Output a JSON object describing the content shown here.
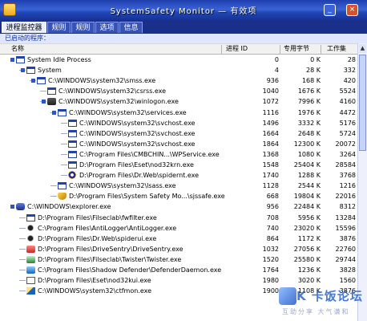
{
  "window": {
    "title": "SystemSafety Monitor — 有效项",
    "minimize_glyph": "_",
    "close_glyph": "×"
  },
  "tabs": [
    {
      "label": "进程监控器",
      "active": true
    },
    {
      "label": "规则",
      "active": false
    },
    {
      "label": "规则",
      "active": false
    },
    {
      "label": "选项",
      "active": false
    },
    {
      "label": "信息",
      "active": false
    }
  ],
  "subheader": "已启动的程序：",
  "columns": {
    "name": "名称",
    "pid": "进程 ID",
    "private_bytes": "专用字节",
    "working_set": "工作集"
  },
  "processes": [
    {
      "name": "System Idle Process",
      "pid": "0",
      "private": "0 K",
      "ws": "28",
      "depth": 0,
      "icon": "window-icon"
    },
    {
      "name": "System",
      "pid": "4",
      "private": "28 K",
      "ws": "332",
      "depth": 1,
      "icon": "window-icon"
    },
    {
      "name": "C:\\WINDOWS\\system32\\smss.exe",
      "pid": "936",
      "private": "168 K",
      "ws": "420",
      "depth": 2,
      "icon": "window-icon"
    },
    {
      "name": "C:\\WINDOWS\\system32\\csrss.exe",
      "pid": "1040",
      "private": "1676 K",
      "ws": "5524",
      "depth": 3,
      "icon": "window-icon"
    },
    {
      "name": "C:\\WINDOWS\\system32\\winlogon.exe",
      "pid": "1072",
      "private": "7996 K",
      "ws": "4160",
      "depth": 3,
      "icon": "lock-icon"
    },
    {
      "name": "C:\\WINDOWS\\system32\\services.exe",
      "pid": "1116",
      "private": "1976 K",
      "ws": "4472",
      "depth": 4,
      "icon": "window-icon"
    },
    {
      "name": "C:\\WINDOWS\\system32\\svchost.exe",
      "pid": "1496",
      "private": "3332 K",
      "ws": "5176",
      "depth": 5,
      "icon": "window-icon"
    },
    {
      "name": "C:\\WINDOWS\\system32\\svchost.exe",
      "pid": "1664",
      "private": "2648 K",
      "ws": "5724",
      "depth": 5,
      "icon": "window-icon"
    },
    {
      "name": "C:\\WINDOWS\\system32\\svchost.exe",
      "pid": "1864",
      "private": "12300 K",
      "ws": "20072",
      "depth": 5,
      "icon": "window-icon"
    },
    {
      "name": "C:\\Program Files\\CMBCHIN...\\WPService.exe",
      "pid": "1368",
      "private": "1080 K",
      "ws": "3264",
      "depth": 5,
      "icon": "window-icon"
    },
    {
      "name": "D:\\Program Files\\Eset\\nod32krn.exe",
      "pid": "1548",
      "private": "25404 K",
      "ws": "28584",
      "depth": 5,
      "icon": "window-icon"
    },
    {
      "name": "D:\\Program Files\\Dr.Web\\spidernt.exe",
      "pid": "1740",
      "private": "1288 K",
      "ws": "3768",
      "depth": 5,
      "icon": "gear-icon"
    },
    {
      "name": "C:\\WINDOWS\\system32\\lsass.exe",
      "pid": "1128",
      "private": "2544 K",
      "ws": "1216",
      "depth": 4,
      "icon": "window-icon"
    },
    {
      "name": "D:\\Program Files\\System Safety Mo...\\sjssafe.exe",
      "pid": "668",
      "private": "19804 K",
      "ws": "22016",
      "depth": 4,
      "icon": "shield-icon"
    },
    {
      "name": "C:\\WINDOWS\\explorer.exe",
      "pid": "956",
      "private": "22484 K",
      "ws": "8312",
      "depth": 0,
      "icon": "user-icon"
    },
    {
      "name": "D:\\Program Files\\Filseclab\\fwfilter.exe",
      "pid": "708",
      "private": "5956 K",
      "ws": "13284",
      "depth": 1,
      "icon": "window-icon"
    },
    {
      "name": "C:\\Program Files\\AntiLogger\\AntiLogger.exe",
      "pid": "740",
      "private": "23020 K",
      "ws": "15596",
      "depth": 1,
      "icon": "spider-icon"
    },
    {
      "name": "D:\\Program Files\\Dr.Web\\spiderui.exe",
      "pid": "864",
      "private": "1172 K",
      "ws": "3876",
      "depth": 1,
      "icon": "spider-icon"
    },
    {
      "name": "D:\\Program Files\\DriveSentry\\DriveSentry.exe",
      "pid": "1032",
      "private": "27056 K",
      "ws": "22760",
      "depth": 1,
      "icon": "red-app-icon"
    },
    {
      "name": "D:\\Program Files\\Filseclab\\Twister\\Twister.exe",
      "pid": "1520",
      "private": "25580 K",
      "ws": "29744",
      "depth": 1,
      "icon": "green-app-icon"
    },
    {
      "name": "C:\\Program Files\\Shadow Defender\\DefenderDaemon.exe",
      "pid": "1764",
      "private": "1236 K",
      "ws": "3828",
      "depth": 1,
      "icon": "blue-app-icon"
    },
    {
      "name": "D:\\Program Files\\Eset\\nod32kui.exe",
      "pid": "1980",
      "private": "3020 K",
      "ws": "1560",
      "depth": 1,
      "icon": "e-app-icon"
    },
    {
      "name": "C:\\WINDOWS\\system32\\ctfmon.exe",
      "pid": "1900",
      "private": "1108 K",
      "ws": "3876",
      "depth": 1,
      "icon": "pen-icon"
    }
  ],
  "watermark": {
    "text": "K 卡饭论坛",
    "sub": "互助分享  大气谦和"
  }
}
